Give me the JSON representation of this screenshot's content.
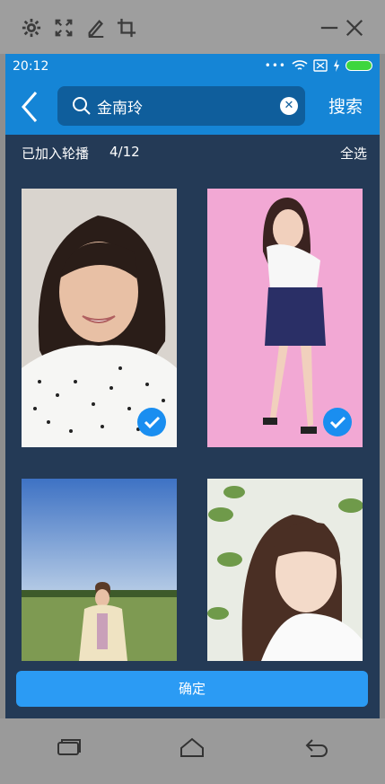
{
  "emulator": {
    "tools": [
      "gear-icon",
      "fullscreen-icon",
      "pen-icon",
      "crop-icon"
    ],
    "window_controls": [
      "minimize-icon",
      "close-icon"
    ]
  },
  "status_bar": {
    "time": "20:12"
  },
  "app_bar": {
    "search_value": "金南玲",
    "search_button": "搜索"
  },
  "sub_header": {
    "added_label": "已加入轮播",
    "count": "4/12",
    "select_all": "全选"
  },
  "photos": [
    {
      "selected": true
    },
    {
      "selected": true
    },
    {
      "selected": false
    },
    {
      "selected": false
    }
  ],
  "confirm_label": "确定",
  "colors": {
    "accent": "#1585d6",
    "screen_bg": "#243a56",
    "check": "#1a8ef0",
    "button": "#2b9bf4"
  }
}
